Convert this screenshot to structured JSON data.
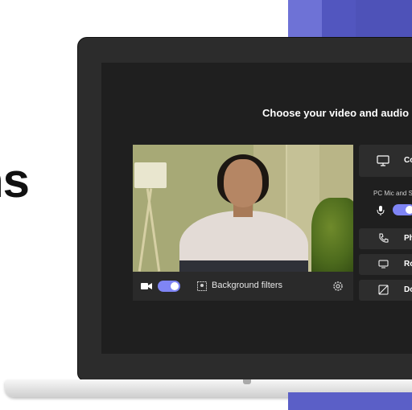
{
  "brand": {
    "partial_text": "ns"
  },
  "screen": {
    "title": "Choose your video and audio",
    "video_bar": {
      "background_filters_label": "Background filters",
      "camera_on": true
    },
    "panel": {
      "options": [
        {
          "label": "Co"
        },
        {
          "label": "Ph"
        },
        {
          "label": "Ro"
        },
        {
          "label": "Do"
        }
      ],
      "pc_mic_label": "PC Mic and S",
      "mic_on": true
    }
  },
  "colors": {
    "accent": "#7f85f5",
    "brand_purple": "#5b5fc7",
    "screen_bg": "#1f1f1f"
  }
}
